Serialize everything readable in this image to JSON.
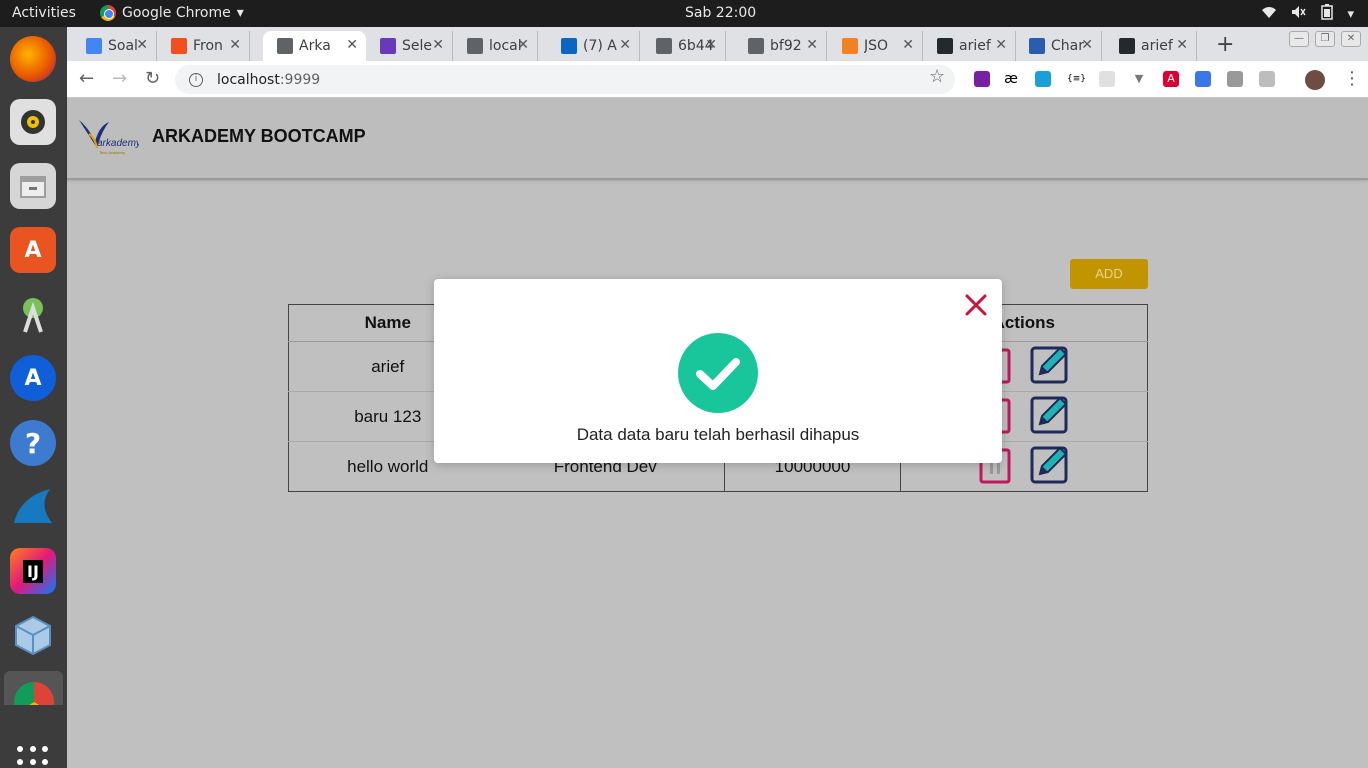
{
  "topbar": {
    "activities": "Activities",
    "app_name": "Google Chrome",
    "clock": "Sab 22:00"
  },
  "browser": {
    "tabs": [
      {
        "label": "Soal",
        "icon": "google-docs-icon",
        "color": "#4285f4"
      },
      {
        "label": "Fron",
        "icon": "figma-icon",
        "color": "#f24e1e"
      },
      {
        "label": "Arka",
        "icon": "page-icon",
        "color": "#5f6368"
      },
      {
        "label": "Sele",
        "icon": "forms-icon",
        "color": "#673ab7"
      },
      {
        "label": "local",
        "icon": "page-icon",
        "color": "#5f6368"
      },
      {
        "label": "(7) A",
        "icon": "linkedin-icon",
        "color": "#0a66c2"
      },
      {
        "label": "6b44",
        "icon": "page-icon",
        "color": "#5f6368"
      },
      {
        "label": "bf92",
        "icon": "page-icon",
        "color": "#5f6368"
      },
      {
        "label": "JSO",
        "icon": "stackoverflow-icon",
        "color": "#f48024"
      },
      {
        "label": "arief",
        "icon": "github-icon",
        "color": "#24292e"
      },
      {
        "label": "Char",
        "icon": "devhints-icon",
        "color": "#2a5db0"
      },
      {
        "label": "arief",
        "icon": "github-icon",
        "color": "#24292e"
      }
    ],
    "active_tab_index": 2,
    "url_host": "localhost",
    "url_port": ":9999"
  },
  "app": {
    "brand": "ARKADEMY BOOTCAMP",
    "logo_text": "arkademy",
    "logo_subtext": "Tech Academy",
    "add_label": "ADD",
    "table": {
      "headers": [
        "Name",
        "",
        "",
        "Actions"
      ],
      "rows": [
        {
          "name": "arief"
        },
        {
          "name": "baru 123"
        },
        {
          "name": "hello world",
          "col2": "Frontend Dev",
          "col3": "10000000"
        }
      ]
    }
  },
  "modal": {
    "message": "Data data baru telah berhasil dihapus",
    "accent": "#19c59b",
    "close_color": "#d0103a"
  }
}
